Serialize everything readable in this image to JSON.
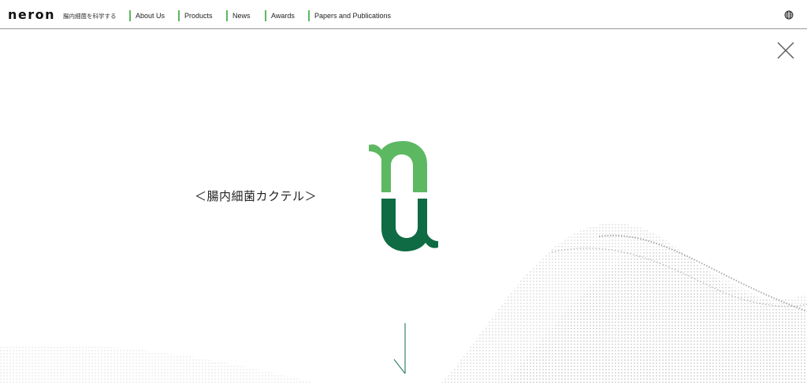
{
  "header": {
    "logo_text": "neron",
    "tagline": "腸内細菌を科学する",
    "nav": [
      {
        "label": "About Us"
      },
      {
        "label": "Products"
      },
      {
        "label": "News"
      },
      {
        "label": "Awards"
      },
      {
        "label": "Papers and Publications"
      }
    ],
    "language_icon": "globe-icon"
  },
  "overlay": {
    "close_icon": "close-icon",
    "product_title": "＜腸内細菌カクテル＞",
    "logo_icon": "nu-logo",
    "scroll_icon": "scroll-down-arrow-icon"
  },
  "colors": {
    "accent_green": "#5cb85c",
    "logo_light_green": "#5db862",
    "logo_dark_green": "#0f6b44"
  }
}
